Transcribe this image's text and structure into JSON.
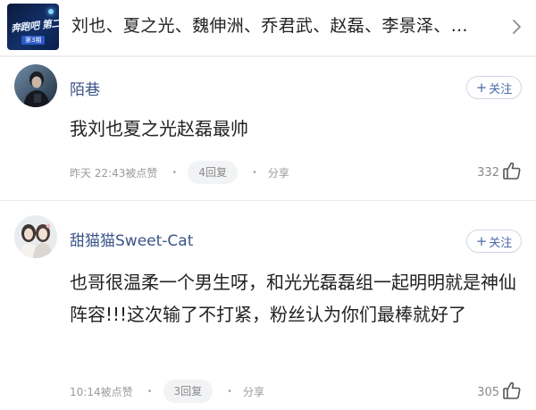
{
  "topic": {
    "thumbnail_title": "奔跑吧 第二季",
    "thumbnail_badge": "第3期",
    "names": "刘也、夏之光、魏伸洲、乔君武、赵磊、李景泽、…",
    "chevron_icon": "chevron-right-icon"
  },
  "comments": [
    {
      "username": "陌巷",
      "follow_label": "关注",
      "follow_icon": "plus-icon",
      "text": "我刘也夏之光赵磊最帅",
      "time": "昨天 22:43被点赞",
      "reply_label": "4回复",
      "share_label": "分享",
      "likes": "332",
      "like_icon": "thumbs-up-icon"
    },
    {
      "username": "甜猫猫Sweet-Cat",
      "follow_label": "关注",
      "follow_icon": "plus-icon",
      "text": "也哥很温柔一个男生呀，和光光磊磊组一起明明就是神仙阵容!!!这次输了不打紧，粉丝认为你们最棒就好了",
      "time": "10:14被点赞",
      "reply_label": "3回复",
      "share_label": "分享",
      "likes": "305",
      "like_icon": "thumbs-up-icon"
    }
  ],
  "colors": {
    "username": "#3b5488",
    "follow_border": "#cfd8e6",
    "meta_text": "#9a9a9a",
    "reply_pill_bg": "#f2f3f5"
  }
}
